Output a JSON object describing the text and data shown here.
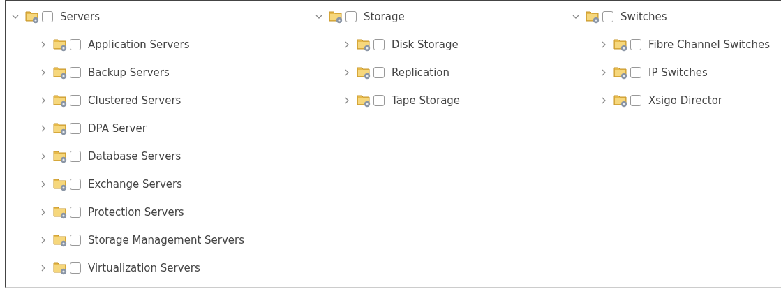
{
  "tree": [
    {
      "label": "Servers",
      "expanded": true,
      "checked": false,
      "children": [
        {
          "label": "Application Servers",
          "expanded": false,
          "checked": false
        },
        {
          "label": "Backup Servers",
          "expanded": false,
          "checked": false
        },
        {
          "label": "Clustered Servers",
          "expanded": false,
          "checked": false
        },
        {
          "label": "DPA Server",
          "expanded": false,
          "checked": false
        },
        {
          "label": "Database Servers",
          "expanded": false,
          "checked": false
        },
        {
          "label": "Exchange Servers",
          "expanded": false,
          "checked": false
        },
        {
          "label": "Protection Servers",
          "expanded": false,
          "checked": false
        },
        {
          "label": "Storage Management Servers",
          "expanded": false,
          "checked": false
        },
        {
          "label": "Virtualization Servers",
          "expanded": false,
          "checked": false
        }
      ]
    },
    {
      "label": "Storage",
      "expanded": true,
      "checked": false,
      "children": [
        {
          "label": "Disk Storage",
          "expanded": false,
          "checked": false
        },
        {
          "label": "Replication",
          "expanded": false,
          "checked": false
        },
        {
          "label": "Tape Storage",
          "expanded": false,
          "checked": false
        }
      ]
    },
    {
      "label": "Switches",
      "expanded": true,
      "checked": false,
      "children": [
        {
          "label": "Fibre Channel Switches",
          "expanded": false,
          "checked": false
        },
        {
          "label": "IP Switches",
          "expanded": false,
          "checked": false
        },
        {
          "label": "Xsigo Director",
          "expanded": false,
          "checked": false
        }
      ]
    }
  ]
}
